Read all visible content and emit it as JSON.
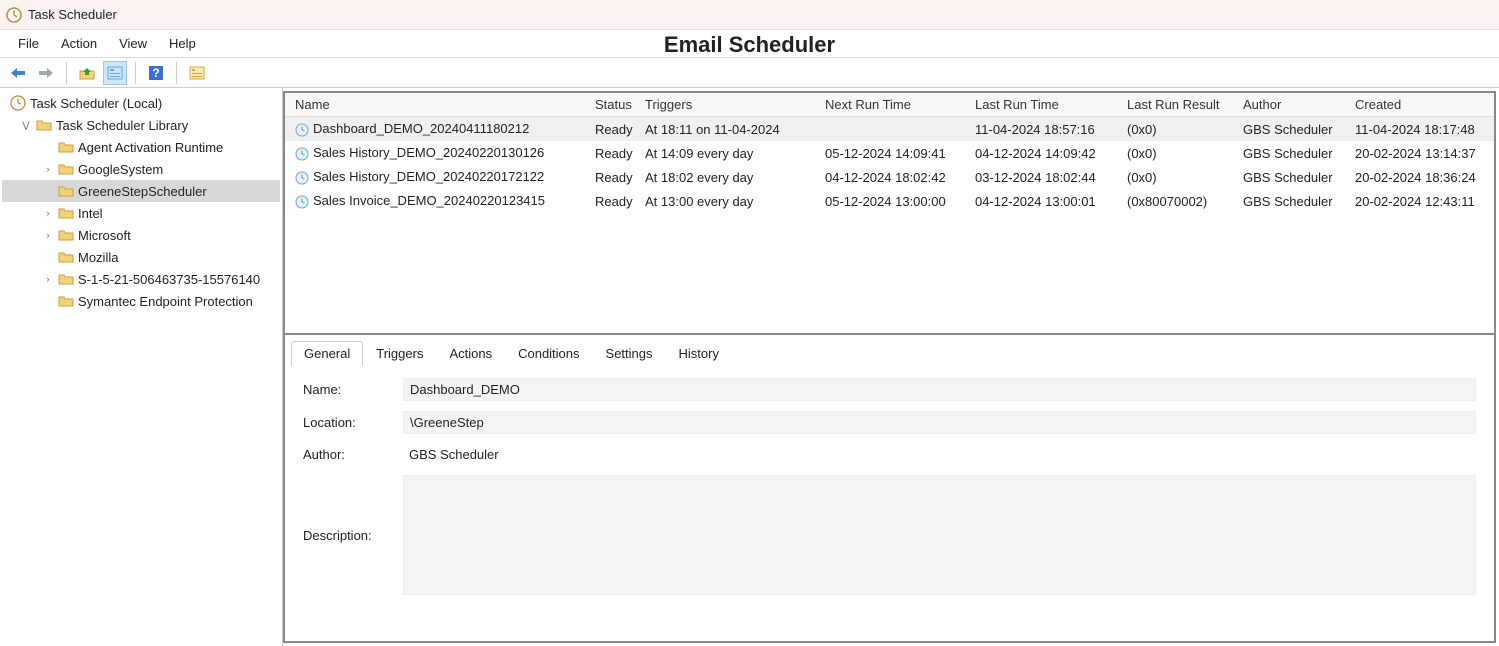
{
  "window": {
    "title": "Task Scheduler"
  },
  "page_heading": "Email Scheduler",
  "menubar": [
    "File",
    "Action",
    "View",
    "Help"
  ],
  "tree": {
    "root": "Task Scheduler (Local)",
    "library": "Task Scheduler Library",
    "items": [
      "Agent Activation Runtime",
      "GoogleSystem",
      "GreeneStepScheduler",
      "Intel",
      "Microsoft",
      "Mozilla",
      "S-1-5-21-506463735-15576140",
      "Symantec Endpoint Protection"
    ],
    "selected": "GreeneStepScheduler"
  },
  "columns": {
    "name": "Name",
    "status": "Status",
    "triggers": "Triggers",
    "next": "Next Run Time",
    "last": "Last Run Time",
    "result": "Last Run Result",
    "author": "Author",
    "created": "Created"
  },
  "tasks": [
    {
      "name": "Dashboard_DEMO_20240411180212",
      "status": "Ready",
      "triggers": "At 18:11 on 11-04-2024",
      "next": "",
      "last": "11-04-2024 18:57:16",
      "result": "(0x0)",
      "author": "GBS Scheduler",
      "created": "11-04-2024 18:17:48",
      "selected": true
    },
    {
      "name": "Sales History_DEMO_20240220130126",
      "status": "Ready",
      "triggers": "At 14:09 every day",
      "next": "05-12-2024 14:09:41",
      "last": "04-12-2024 14:09:42",
      "result": "(0x0)",
      "author": "GBS Scheduler",
      "created": "20-02-2024 13:14:37"
    },
    {
      "name": "Sales History_DEMO_20240220172122",
      "status": "Ready",
      "triggers": "At 18:02 every day",
      "next": "04-12-2024 18:02:42",
      "last": "03-12-2024 18:02:44",
      "result": "(0x0)",
      "author": "GBS Scheduler",
      "created": "20-02-2024 18:36:24"
    },
    {
      "name": "Sales Invoice_DEMO_20240220123415",
      "status": "Ready",
      "triggers": "At 13:00 every day",
      "next": "05-12-2024 13:00:00",
      "last": "04-12-2024 13:00:01",
      "result": "(0x80070002)",
      "author": "GBS Scheduler",
      "created": "20-02-2024 12:43:11"
    }
  ],
  "detailTabs": [
    "General",
    "Triggers",
    "Actions",
    "Conditions",
    "Settings",
    "History"
  ],
  "detail": {
    "nameLabel": "Name:",
    "name": "Dashboard_DEMO",
    "locationLabel": "Location:",
    "location": "\\GreeneStep",
    "authorLabel": "Author:",
    "author": "GBS Scheduler",
    "descriptionLabel": "Description:",
    "description": ""
  }
}
